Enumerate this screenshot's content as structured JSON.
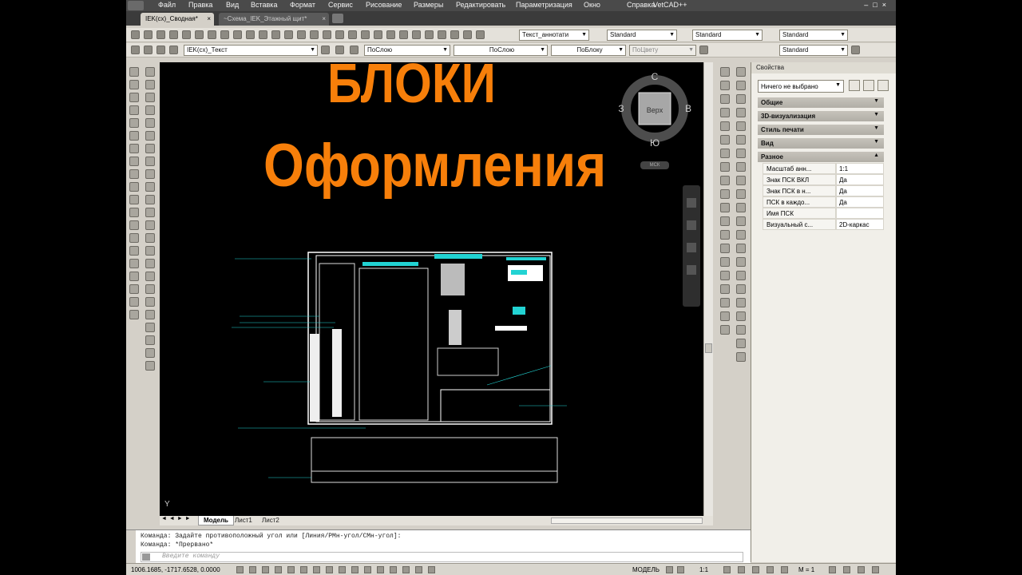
{
  "menu": {
    "items": [
      "Файл",
      "Правка",
      "Вид",
      "Вставка",
      "Формат",
      "Сервис",
      "Рисование",
      "Размеры",
      "Редактировать",
      "Параметризация",
      "Окно",
      "Справка",
      "VetCAD++"
    ]
  },
  "doc_tabs": [
    {
      "label": "IEK(сх)_Сводная*",
      "close": "×"
    },
    {
      "label": "~Схема_IEK_Этажный щит*",
      "close": "×"
    }
  ],
  "toolbar1": {
    "text_style": "Текст_аннотати",
    "dim_style": "Standard",
    "table_style": "Standard",
    "multileader_style": "Standard"
  },
  "toolbar2": {
    "layer": "IEK(сх)_Текст",
    "color": "ПоСлою",
    "linetype": "ПоСлою",
    "lineweight": "ПоБлоку",
    "plot_style": "ПоЦвету",
    "visual_style": "Standard"
  },
  "canvas": {
    "title1": "БЛОКИ",
    "title2": "Оформления",
    "viewcube": {
      "top": "Верх",
      "n": "С",
      "s": "Ю",
      "e": "В",
      "w": "З",
      "wcs": "МСК"
    },
    "ucs_y": "Y"
  },
  "layout_tabs": [
    "Модель",
    "Лист1",
    "Лист2"
  ],
  "properties": {
    "title": "Свойства",
    "selection": "Ничего не выбрано",
    "sections": [
      "Общие",
      "3D-визуализация",
      "Стиль печати",
      "Вид",
      "Разное"
    ],
    "rows": [
      {
        "k": "Масштаб анн...",
        "v": "1:1"
      },
      {
        "k": "Знак ПСК ВКЛ",
        "v": "Да"
      },
      {
        "k": "Знак ПСК в н...",
        "v": "Да"
      },
      {
        "k": "ПСК в каждо...",
        "v": "Да"
      },
      {
        "k": "Имя ПСК",
        "v": ""
      },
      {
        "k": "Визуальный с...",
        "v": "2D-каркас"
      }
    ]
  },
  "command": {
    "line1": "Команда: Задайте противоположный угол или [Линия/РМн-угол/СМн-угол]:",
    "line2": "Команда: *Прервано*",
    "placeholder": "Введите команду"
  },
  "status": {
    "coords": "1006.1685, -1717.6528, 0.0000",
    "model": "МОДЕЛЬ",
    "scale": "1:1",
    "m": "M = 1"
  }
}
